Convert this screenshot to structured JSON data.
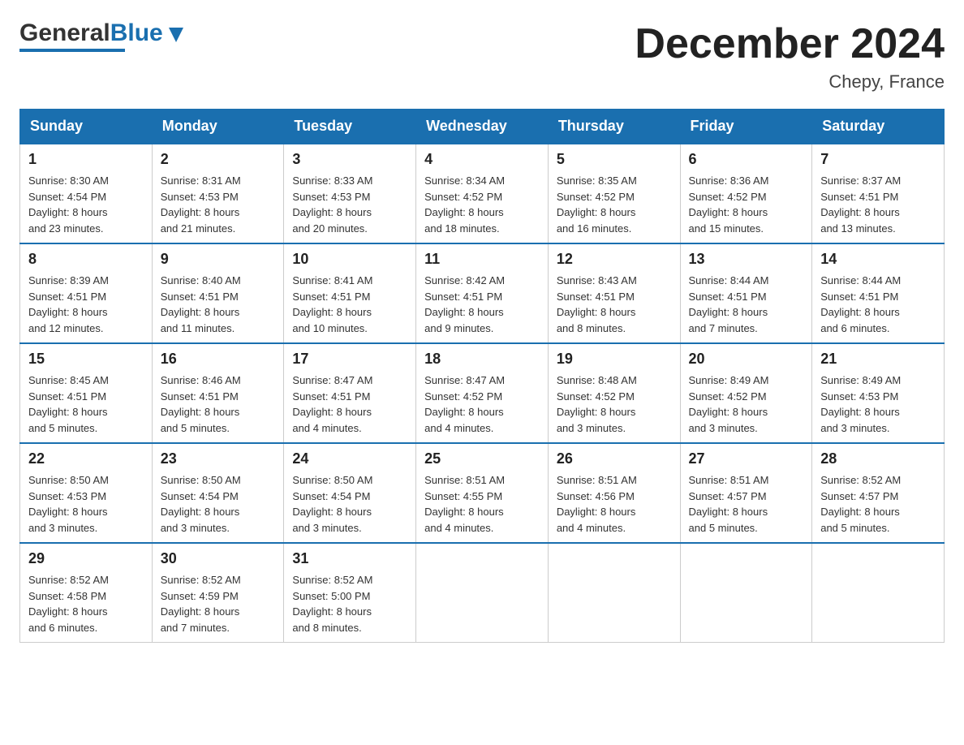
{
  "header": {
    "logo_general": "General",
    "logo_blue": "Blue",
    "month_title": "December 2024",
    "location": "Chepy, France"
  },
  "days_of_week": [
    "Sunday",
    "Monday",
    "Tuesday",
    "Wednesday",
    "Thursday",
    "Friday",
    "Saturday"
  ],
  "weeks": [
    [
      {
        "day": "1",
        "sunrise": "8:30 AM",
        "sunset": "4:54 PM",
        "daylight": "8 hours and 23 minutes."
      },
      {
        "day": "2",
        "sunrise": "8:31 AM",
        "sunset": "4:53 PM",
        "daylight": "8 hours and 21 minutes."
      },
      {
        "day": "3",
        "sunrise": "8:33 AM",
        "sunset": "4:53 PM",
        "daylight": "8 hours and 20 minutes."
      },
      {
        "day": "4",
        "sunrise": "8:34 AM",
        "sunset": "4:52 PM",
        "daylight": "8 hours and 18 minutes."
      },
      {
        "day": "5",
        "sunrise": "8:35 AM",
        "sunset": "4:52 PM",
        "daylight": "8 hours and 16 minutes."
      },
      {
        "day": "6",
        "sunrise": "8:36 AM",
        "sunset": "4:52 PM",
        "daylight": "8 hours and 15 minutes."
      },
      {
        "day": "7",
        "sunrise": "8:37 AM",
        "sunset": "4:51 PM",
        "daylight": "8 hours and 13 minutes."
      }
    ],
    [
      {
        "day": "8",
        "sunrise": "8:39 AM",
        "sunset": "4:51 PM",
        "daylight": "8 hours and 12 minutes."
      },
      {
        "day": "9",
        "sunrise": "8:40 AM",
        "sunset": "4:51 PM",
        "daylight": "8 hours and 11 minutes."
      },
      {
        "day": "10",
        "sunrise": "8:41 AM",
        "sunset": "4:51 PM",
        "daylight": "8 hours and 10 minutes."
      },
      {
        "day": "11",
        "sunrise": "8:42 AM",
        "sunset": "4:51 PM",
        "daylight": "8 hours and 9 minutes."
      },
      {
        "day": "12",
        "sunrise": "8:43 AM",
        "sunset": "4:51 PM",
        "daylight": "8 hours and 8 minutes."
      },
      {
        "day": "13",
        "sunrise": "8:44 AM",
        "sunset": "4:51 PM",
        "daylight": "8 hours and 7 minutes."
      },
      {
        "day": "14",
        "sunrise": "8:44 AM",
        "sunset": "4:51 PM",
        "daylight": "8 hours and 6 minutes."
      }
    ],
    [
      {
        "day": "15",
        "sunrise": "8:45 AM",
        "sunset": "4:51 PM",
        "daylight": "8 hours and 5 minutes."
      },
      {
        "day": "16",
        "sunrise": "8:46 AM",
        "sunset": "4:51 PM",
        "daylight": "8 hours and 5 minutes."
      },
      {
        "day": "17",
        "sunrise": "8:47 AM",
        "sunset": "4:51 PM",
        "daylight": "8 hours and 4 minutes."
      },
      {
        "day": "18",
        "sunrise": "8:47 AM",
        "sunset": "4:52 PM",
        "daylight": "8 hours and 4 minutes."
      },
      {
        "day": "19",
        "sunrise": "8:48 AM",
        "sunset": "4:52 PM",
        "daylight": "8 hours and 3 minutes."
      },
      {
        "day": "20",
        "sunrise": "8:49 AM",
        "sunset": "4:52 PM",
        "daylight": "8 hours and 3 minutes."
      },
      {
        "day": "21",
        "sunrise": "8:49 AM",
        "sunset": "4:53 PM",
        "daylight": "8 hours and 3 minutes."
      }
    ],
    [
      {
        "day": "22",
        "sunrise": "8:50 AM",
        "sunset": "4:53 PM",
        "daylight": "8 hours and 3 minutes."
      },
      {
        "day": "23",
        "sunrise": "8:50 AM",
        "sunset": "4:54 PM",
        "daylight": "8 hours and 3 minutes."
      },
      {
        "day": "24",
        "sunrise": "8:50 AM",
        "sunset": "4:54 PM",
        "daylight": "8 hours and 3 minutes."
      },
      {
        "day": "25",
        "sunrise": "8:51 AM",
        "sunset": "4:55 PM",
        "daylight": "8 hours and 4 minutes."
      },
      {
        "day": "26",
        "sunrise": "8:51 AM",
        "sunset": "4:56 PM",
        "daylight": "8 hours and 4 minutes."
      },
      {
        "day": "27",
        "sunrise": "8:51 AM",
        "sunset": "4:57 PM",
        "daylight": "8 hours and 5 minutes."
      },
      {
        "day": "28",
        "sunrise": "8:52 AM",
        "sunset": "4:57 PM",
        "daylight": "8 hours and 5 minutes."
      }
    ],
    [
      {
        "day": "29",
        "sunrise": "8:52 AM",
        "sunset": "4:58 PM",
        "daylight": "8 hours and 6 minutes."
      },
      {
        "day": "30",
        "sunrise": "8:52 AM",
        "sunset": "4:59 PM",
        "daylight": "8 hours and 7 minutes."
      },
      {
        "day": "31",
        "sunrise": "8:52 AM",
        "sunset": "5:00 PM",
        "daylight": "8 hours and 8 minutes."
      },
      null,
      null,
      null,
      null
    ]
  ],
  "labels": {
    "sunrise": "Sunrise:",
    "sunset": "Sunset:",
    "daylight": "Daylight:"
  }
}
